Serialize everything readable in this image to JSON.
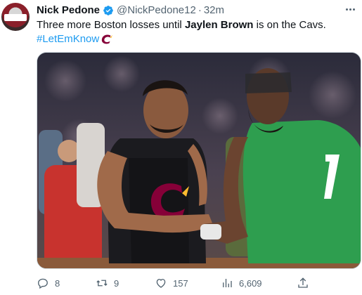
{
  "tweet": {
    "author_name": "Nick Pedone",
    "handle": "@NickPedone12",
    "separator": "·",
    "time": "32m",
    "text_before": "Three more Boston losses until ",
    "text_bold": "Jaylen Brown",
    "text_after": " is on the Cavs.",
    "hashtag": "#LetEmKnow"
  },
  "actions": {
    "replies": "8",
    "reposts": "9",
    "likes": "157",
    "views": "6,609"
  },
  "icons": {
    "verified": "verified-badge-icon",
    "more": "more-options-icon",
    "reply": "reply-icon",
    "repost": "repost-icon",
    "like": "heart-icon",
    "views": "views-chart-icon",
    "share": "share-icon",
    "hashflag": "cavs-c-icon"
  },
  "colors": {
    "accent": "#1d9bf0",
    "muted": "#536471",
    "text": "#0f1419",
    "cavs_wine": "#860038",
    "cavs_gold": "#FDBB30",
    "celtics_green": "#2e9e4f"
  }
}
